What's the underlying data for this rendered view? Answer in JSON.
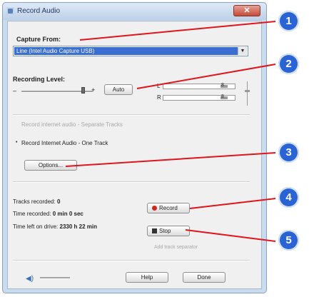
{
  "window": {
    "title": "Record Audio",
    "close_glyph": "✕"
  },
  "capture": {
    "label": "Capture From:",
    "selected": "Line (Intel Audio Capture USB)"
  },
  "recording_level": {
    "label": "Recording Level:",
    "minus": "–",
    "plus": "+",
    "auto_label": "Auto",
    "channels": [
      {
        "name": "L",
        "reading": "8"
      },
      {
        "name": "R",
        "reading": "8"
      }
    ]
  },
  "record_stereo": {
    "label": "Record internet audio - Separate Tracks"
  },
  "record_one": {
    "label": "Record Internet Audio - One Track"
  },
  "options_label": "Options...",
  "stats": {
    "tracks_label": "Tracks recorded:",
    "tracks_value": "0",
    "time_label": "Time recorded:",
    "time_value": "0 min 0 sec",
    "left_label": "Time left on drive:",
    "left_value": "2330 h 22 min"
  },
  "controls": {
    "record": "Record",
    "stop": "Stop",
    "add": "Add track separator"
  },
  "footer": {
    "help": "Help",
    "done": "Done"
  },
  "callouts": [
    "1",
    "2",
    "3",
    "4",
    "5"
  ],
  "colors": {
    "callout": "#2a64d4",
    "lead_line": "#e0141b",
    "record_dot": "#d42a1e",
    "selection": "#3a6fd1"
  }
}
